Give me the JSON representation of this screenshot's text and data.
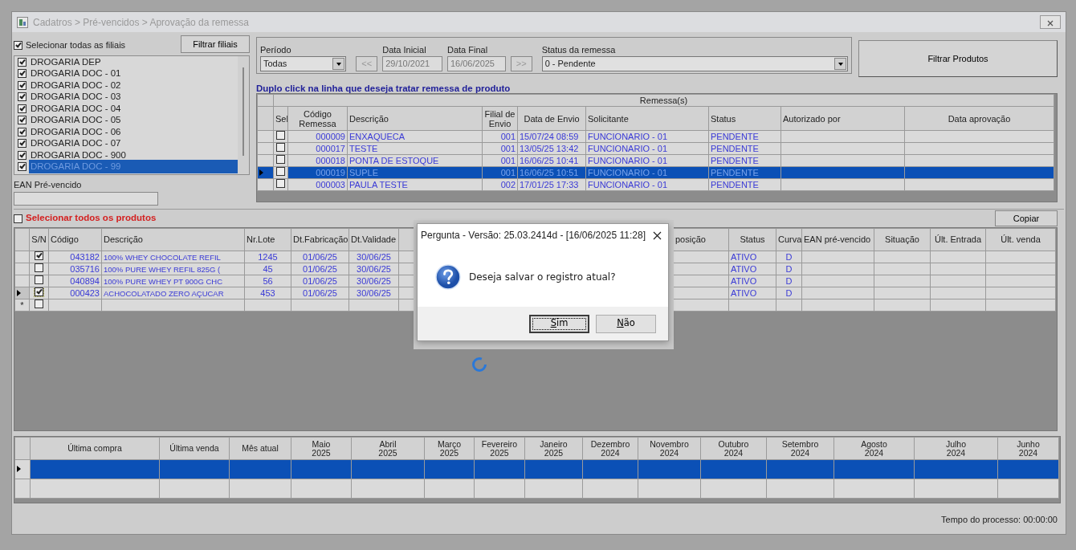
{
  "window": {
    "title": "Cadatros > Pré-vencidos > Aprovação da remessa"
  },
  "filiais": {
    "select_all": {
      "label": "Selecionar todas as filiais",
      "checked": true
    },
    "filter_button": "Filtrar filiais",
    "items": [
      {
        "label": "DROGARIA DEP",
        "checked": true,
        "selected": false
      },
      {
        "label": "DROGARIA DOC - 01",
        "checked": true,
        "selected": false
      },
      {
        "label": "DROGARIA DOC - 02",
        "checked": true,
        "selected": false
      },
      {
        "label": "DROGARIA DOC - 03",
        "checked": true,
        "selected": false
      },
      {
        "label": "DROGARIA DOC - 04",
        "checked": true,
        "selected": false
      },
      {
        "label": "DROGARIA DOC - 05",
        "checked": true,
        "selected": false
      },
      {
        "label": "DROGARIA DOC - 06",
        "checked": true,
        "selected": false
      },
      {
        "label": "DROGARIA DOC - 07",
        "checked": true,
        "selected": false
      },
      {
        "label": "DROGARIA DOC - 900",
        "checked": true,
        "selected": false
      },
      {
        "label": "DROGARIA DOC - 99",
        "checked": true,
        "selected": true
      }
    ],
    "ean_label": "EAN Pré-vencido"
  },
  "filters": {
    "periodo_label": "Período",
    "periodo_value": "Todas",
    "prev_button": "<<",
    "data_inicial_label": "Data Inicial",
    "data_inicial": "29/10/2021",
    "data_final_label": "Data Final",
    "data_final": "16/06/2025",
    "next_button": ">>",
    "status_label": "Status da remessa",
    "status_value": "0 - Pendente",
    "filter_button": "Filtrar Produtos"
  },
  "hint": "Duplo click na linha que deseja tratar remessa de produto",
  "remessas": {
    "title": "Remessa(s)",
    "columns": [
      "Sel",
      "Código Remessa",
      "Descrição",
      "Filial de Envio",
      "Data de Envio",
      "Solicitante",
      "Status",
      "Autorizado por",
      "Data aprovação"
    ],
    "rows": [
      {
        "checked": false,
        "selected": false,
        "codigo": "000009",
        "descricao": "ENXAQUECA",
        "filial": "001",
        "data": "15/07/24 08:59",
        "solicitante": "FUNCIONARIO - 01",
        "status": "PENDENTE"
      },
      {
        "checked": false,
        "selected": false,
        "codigo": "000017",
        "descricao": "TESTE",
        "filial": "001",
        "data": "13/05/25 13:42",
        "solicitante": "FUNCIONARIO - 01",
        "status": "PENDENTE"
      },
      {
        "checked": false,
        "selected": false,
        "codigo": "000018",
        "descricao": "PONTA DE ESTOQUE",
        "filial": "001",
        "data": "16/06/25 10:41",
        "solicitante": "FUNCIONARIO - 01",
        "status": "PENDENTE"
      },
      {
        "checked": false,
        "selected": true,
        "codigo": "000019",
        "descricao": "SUPLE",
        "filial": "001",
        "data": "16/06/25 10:51",
        "solicitante": "FUNCIONARIO - 01",
        "status": "PENDENTE"
      },
      {
        "checked": false,
        "selected": false,
        "codigo": "000003",
        "descricao": "PAULA TESTE",
        "filial": "002",
        "data": "17/01/25 17:33",
        "solicitante": "FUNCIONARIO - 01",
        "status": "PENDENTE"
      }
    ]
  },
  "produtos": {
    "select_all": {
      "label": "Selecionar todos os produtos",
      "checked": false
    },
    "copy_button": "Copiar",
    "columns": [
      "S/N",
      "Código",
      "Descrição",
      "Nr.Lote",
      "Dt.Fabricação",
      "Dt.Validade",
      "posição",
      "Status",
      "Curva",
      "EAN pré-vencido",
      "Situação",
      "Últ. Entrada",
      "Últ. venda"
    ],
    "rows": [
      {
        "checked": true,
        "selected": false,
        "codigo": "043182",
        "descricao": "100% WHEY CHOCOLATE REFIL",
        "lote": "1245",
        "fabricacao": "01/06/25",
        "validade": "30/06/25",
        "status": "ATIVO",
        "curva": "D"
      },
      {
        "checked": false,
        "selected": false,
        "codigo": "035716",
        "descricao": "100% PURE WHEY REFIL 825G (",
        "lote": "45",
        "fabricacao": "01/06/25",
        "validade": "30/06/25",
        "status": "ATIVO",
        "curva": "D"
      },
      {
        "checked": false,
        "selected": false,
        "codigo": "040894",
        "descricao": "100% PURE WHEY PT 900G CHC",
        "lote": "56",
        "fabricacao": "01/06/25",
        "validade": "30/06/25",
        "status": "ATIVO",
        "curva": "D"
      },
      {
        "checked": true,
        "selected": true,
        "codigo": "000423",
        "descricao": "ACHOCOLATADO ZERO AÇUCAR",
        "lote": "453",
        "fabricacao": "01/06/25",
        "validade": "30/06/25",
        "status": "ATIVO",
        "curva": "D"
      }
    ],
    "new_row_marker": "*",
    "new_row_checked": false
  },
  "historico": {
    "columns": [
      [
        "Última compra"
      ],
      [
        "Última venda"
      ],
      [
        "Mês atual"
      ],
      [
        "Maio",
        "2025"
      ],
      [
        "Abril",
        "2025"
      ],
      [
        "Março",
        "2025"
      ],
      [
        "Fevereiro",
        "2025"
      ],
      [
        "Janeiro",
        "2025"
      ],
      [
        "Dezembro",
        "2024"
      ],
      [
        "Novembro",
        "2024"
      ],
      [
        "Outubro",
        "2024"
      ],
      [
        "Setembro",
        "2024"
      ],
      [
        "Agosto",
        "2024"
      ],
      [
        "Julho",
        "2024"
      ],
      [
        "Junho",
        "2024"
      ]
    ],
    "rows": [
      {
        "selected": true
      },
      {
        "selected": false
      }
    ]
  },
  "status_bar": "Tempo do processo: 00:00:00",
  "dialog": {
    "title": "Pergunta - Versão: 25.03.2414d - [16/06/2025 11:28]",
    "message": "Deseja salvar o registro atual?",
    "buttons": [
      {
        "label": "Sim",
        "default": true,
        "underline_first": true
      },
      {
        "label": "Não",
        "default": false,
        "underline_first": true
      }
    ]
  },
  "busy": true
}
